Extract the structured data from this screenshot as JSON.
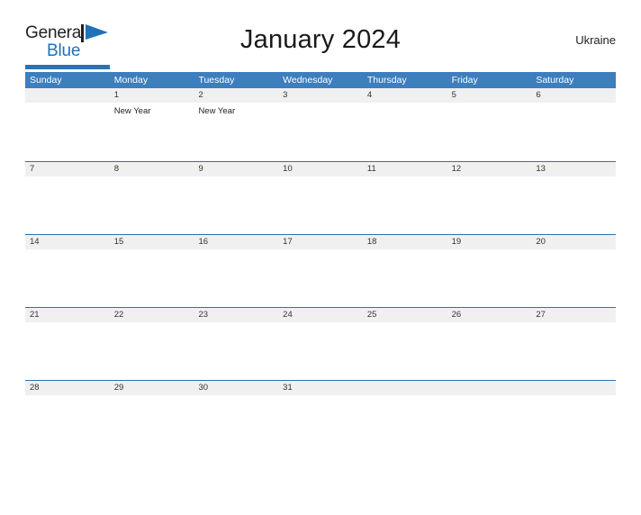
{
  "brand": {
    "name_part1": "General",
    "name_part2": "Blue",
    "flag_icon": "triangle-flag-icon",
    "accent_color": "#2a72b5",
    "text_color": "#231f20"
  },
  "header": {
    "title": "January 2024",
    "region": "Ukraine"
  },
  "calendar": {
    "header_bg": "#3d7ebd",
    "date_band_bg": "#f0f0f0",
    "row_border_color": "#2a72b5",
    "weekdays": [
      "Sunday",
      "Monday",
      "Tuesday",
      "Wednesday",
      "Thursday",
      "Friday",
      "Saturday"
    ],
    "weeks": [
      {
        "days": [
          {
            "num": "",
            "events": []
          },
          {
            "num": "1",
            "events": [
              "New Year"
            ]
          },
          {
            "num": "2",
            "events": [
              "New Year"
            ]
          },
          {
            "num": "3",
            "events": []
          },
          {
            "num": "4",
            "events": []
          },
          {
            "num": "5",
            "events": []
          },
          {
            "num": "6",
            "events": []
          }
        ]
      },
      {
        "days": [
          {
            "num": "7",
            "events": []
          },
          {
            "num": "8",
            "events": []
          },
          {
            "num": "9",
            "events": []
          },
          {
            "num": "10",
            "events": []
          },
          {
            "num": "11",
            "events": []
          },
          {
            "num": "12",
            "events": []
          },
          {
            "num": "13",
            "events": []
          }
        ]
      },
      {
        "days": [
          {
            "num": "14",
            "events": []
          },
          {
            "num": "15",
            "events": []
          },
          {
            "num": "16",
            "events": []
          },
          {
            "num": "17",
            "events": []
          },
          {
            "num": "18",
            "events": []
          },
          {
            "num": "19",
            "events": []
          },
          {
            "num": "20",
            "events": []
          }
        ]
      },
      {
        "days": [
          {
            "num": "21",
            "events": []
          },
          {
            "num": "22",
            "events": []
          },
          {
            "num": "23",
            "events": []
          },
          {
            "num": "24",
            "events": []
          },
          {
            "num": "25",
            "events": []
          },
          {
            "num": "26",
            "events": []
          },
          {
            "num": "27",
            "events": []
          }
        ]
      },
      {
        "days": [
          {
            "num": "28",
            "events": []
          },
          {
            "num": "29",
            "events": []
          },
          {
            "num": "30",
            "events": []
          },
          {
            "num": "31",
            "events": []
          },
          {
            "num": "",
            "events": []
          },
          {
            "num": "",
            "events": []
          },
          {
            "num": "",
            "events": []
          }
        ]
      }
    ]
  }
}
